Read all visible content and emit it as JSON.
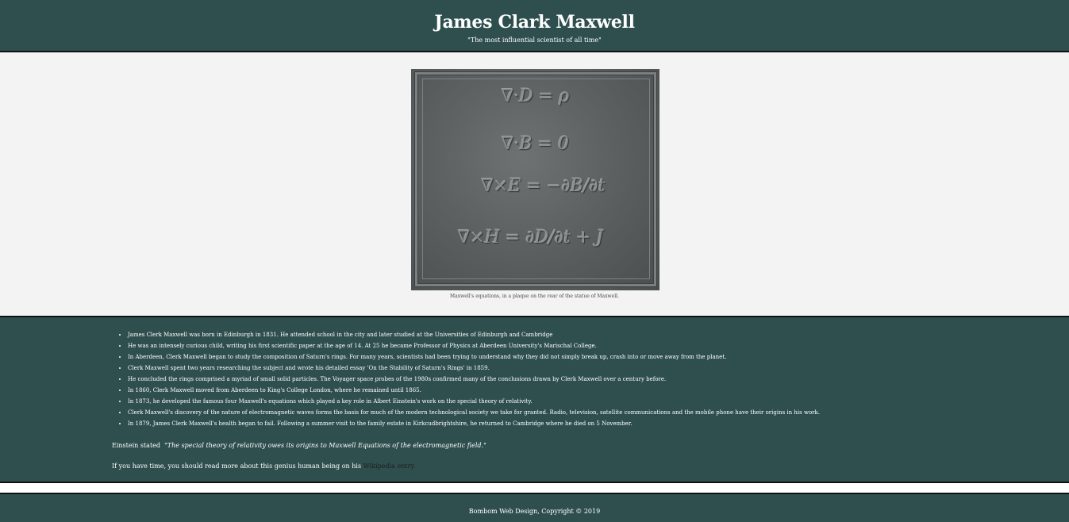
{
  "header": {
    "title": "James Clark Maxwell",
    "subtitle": "\"The most influential scientist of all time\""
  },
  "figure": {
    "equations": [
      "∇·D = ρ",
      "∇·B = 0",
      "∇×E = −∂B/∂t",
      "∇×H = ∂D/∂t + J"
    ],
    "caption": "Maxwell's equations, in a plaque on the rear of the statue of Maxwell."
  },
  "facts": [
    "James Clerk Maxwell was born in Edinburgh in 1831. He attended school in the city and later studied at the Universities of Edinburgh and Cambridge",
    "He was an intensely curious child, writing his first scientific paper at the age of 14. At 25 he became Professor of Physics at Aberdeen University's Marischal College.",
    "In Aberdeen, Clerk Maxwell began to study the composition of Saturn's rings. For many years, scientists had been trying to understand why they did not simply break up, crash into or move away from the planet.",
    "Clerk Maxwell spent two years researching the subject and wrote his detailed essay 'On the Stability of Saturn's Rings' in 1859.",
    "He concluded the rings comprised a myriad of small solid particles. The Voyager space probes of the 1980s confirmed many of the conclusions drawn by Clerk Maxwell over a century before.",
    "In 1860, Clerk Maxwell moved from Aberdeen to King's College London, where he remained until 1865.",
    "In 1873, he developed the famous four Maxwell's equations which played a key role in Albert Einstein's work on the special theory of relativity.",
    "Clerk Maxwell's discovery of the nature of electromagnetic waves forms the basis for much of the modern technological society we take for granted. Radio, television, satellite communications and the mobile phone have their origins in his work.",
    "In 1879, James Clerk Maxwell's health began to fail. Following a summer visit to the family estate in Kirkcudbrightshire, he returned to Cambridge where he died on 5 November."
  ],
  "quote": {
    "prefix": "Einstein stated",
    "text": "\"The special theory of relativity owes its origins to Maxwell Equations of the electromagnetic field.\""
  },
  "more": {
    "prefix": "If you have time, you should read more about this genius human being on his",
    "link_label": "Wikipedia entry."
  },
  "footer": {
    "text": "Bombom Web Design, Copyright © 2019"
  },
  "colors": {
    "band": "#2f4f4f",
    "image_bg": "#f3f3f3",
    "border": "#111111"
  }
}
